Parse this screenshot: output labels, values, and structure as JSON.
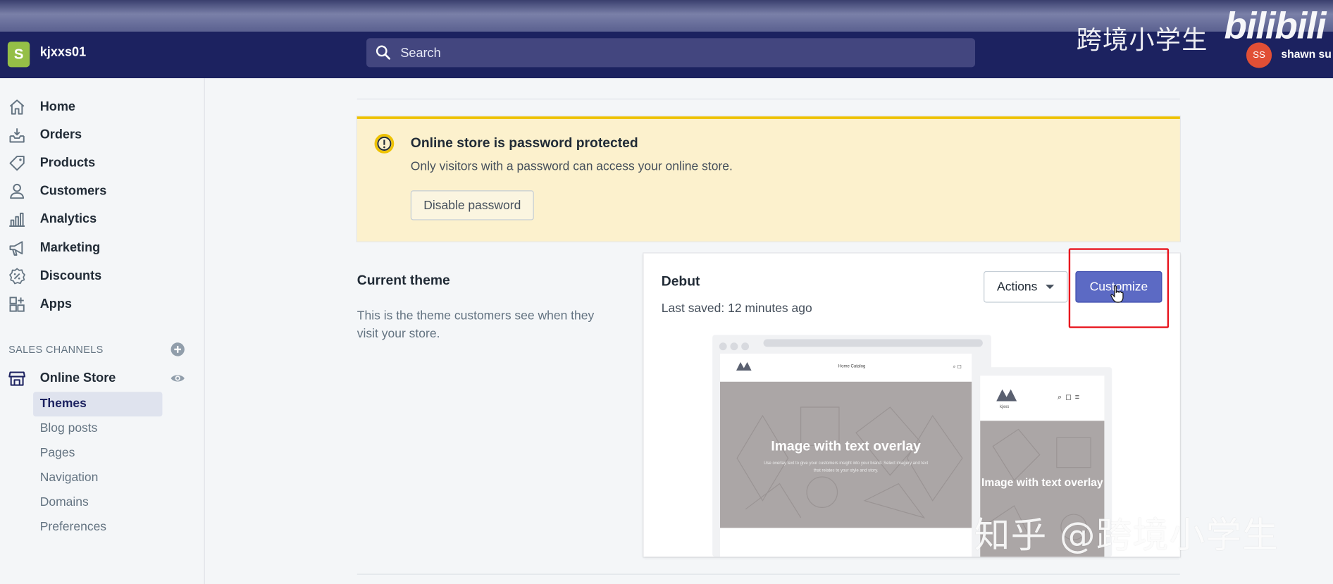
{
  "header": {
    "store_name": "kjxxs01",
    "logo_glyph": "S",
    "search_placeholder": "Search",
    "user_initials": "SS",
    "user_name": "shawn su",
    "watermark_text": "跨境小学生",
    "platform_logo": "bilibili"
  },
  "sidebar": {
    "items": [
      {
        "label": "Home",
        "icon": "home-icon"
      },
      {
        "label": "Orders",
        "icon": "orders-icon"
      },
      {
        "label": "Products",
        "icon": "tag-icon"
      },
      {
        "label": "Customers",
        "icon": "person-icon"
      },
      {
        "label": "Analytics",
        "icon": "bar-chart-icon"
      },
      {
        "label": "Marketing",
        "icon": "megaphone-icon"
      },
      {
        "label": "Discounts",
        "icon": "discount-icon"
      },
      {
        "label": "Apps",
        "icon": "apps-icon"
      }
    ],
    "sales_channels_heading": "SALES CHANNELS",
    "online_store": {
      "label": "Online Store",
      "icon": "store-icon"
    },
    "subitems": [
      {
        "label": "Themes",
        "active": true
      },
      {
        "label": "Blog posts"
      },
      {
        "label": "Pages"
      },
      {
        "label": "Navigation"
      },
      {
        "label": "Domains"
      },
      {
        "label": "Preferences"
      }
    ]
  },
  "banner": {
    "title": "Online store is password protected",
    "text": "Only visitors with a password can access your online store.",
    "button_label": "Disable password"
  },
  "current_theme": {
    "title": "Current theme",
    "description": "This is the theme customers see when they visit your store."
  },
  "theme_card": {
    "name": "Debut",
    "last_saved": "Last saved: 12 minutes ago",
    "actions_label": "Actions",
    "customize_label": "Customize"
  },
  "preview": {
    "desktop_title": "Image with text overlay",
    "desktop_subtitle": "Use overlay text to give your customers insight into your brand. Select imagery and text that relates to your style and story.",
    "desktop_nav": "Home   Catalog",
    "mobile_title": "Image with text overlay",
    "mobile_logo_text": "kjxxs"
  },
  "watermark_bottom": "知乎 @跨境小学生",
  "colors": {
    "topbar": "#1c2260",
    "accent": "#5c6ac4",
    "banner_bg": "#fcf1cd",
    "banner_border": "#eec200",
    "highlight": "#e8141d",
    "logo": "#95bf47"
  }
}
